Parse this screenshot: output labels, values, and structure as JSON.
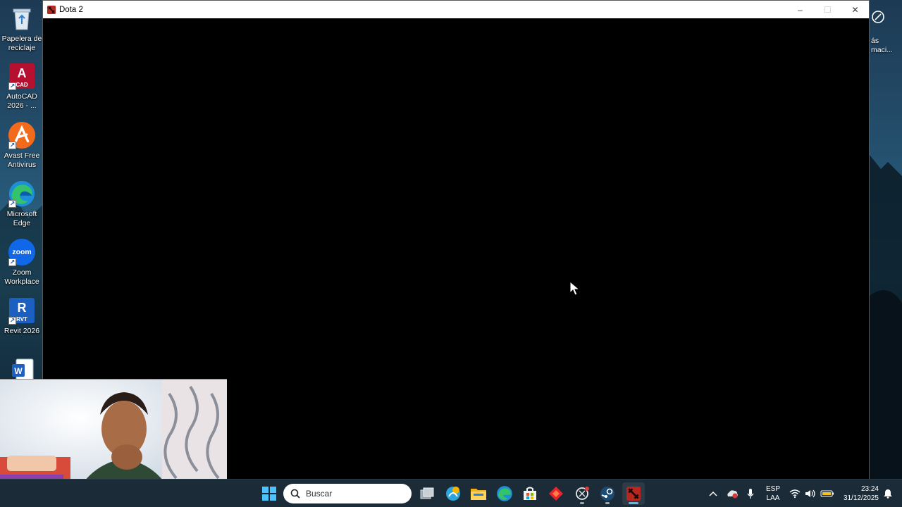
{
  "desktop": {
    "icons": [
      {
        "label": "Papelera de reciclaje",
        "icon": "recycle-bin-icon"
      },
      {
        "label": "AutoCAD 2026 - ...",
        "icon": "autocad-icon",
        "badge": "CAD"
      },
      {
        "label": "Avast Free Antivirus",
        "icon": "avast-icon"
      },
      {
        "label": "Microsoft Edge",
        "icon": "edge-icon"
      },
      {
        "label": "Zoom Workplace",
        "icon": "zoom-icon",
        "badge": "zoom"
      },
      {
        "label": "Revit 2026",
        "icon": "revit-icon",
        "badge": "RVT"
      },
      {
        "label": "",
        "icon": "word-icon"
      }
    ],
    "right_peek": {
      "line1": "ás",
      "line2": "maci..."
    }
  },
  "window": {
    "title": "Dota 2",
    "minimize": "–",
    "maximize": "☐",
    "close": "✕"
  },
  "taskbar": {
    "search_placeholder": "Buscar",
    "language": "ESP",
    "layout": "LAA",
    "time": "23:24",
    "date": "31/12/2025"
  },
  "colors": {
    "taskbar_bg": "#1c2b38",
    "window_bg": "#000000",
    "accent": "#5cb6f0"
  }
}
